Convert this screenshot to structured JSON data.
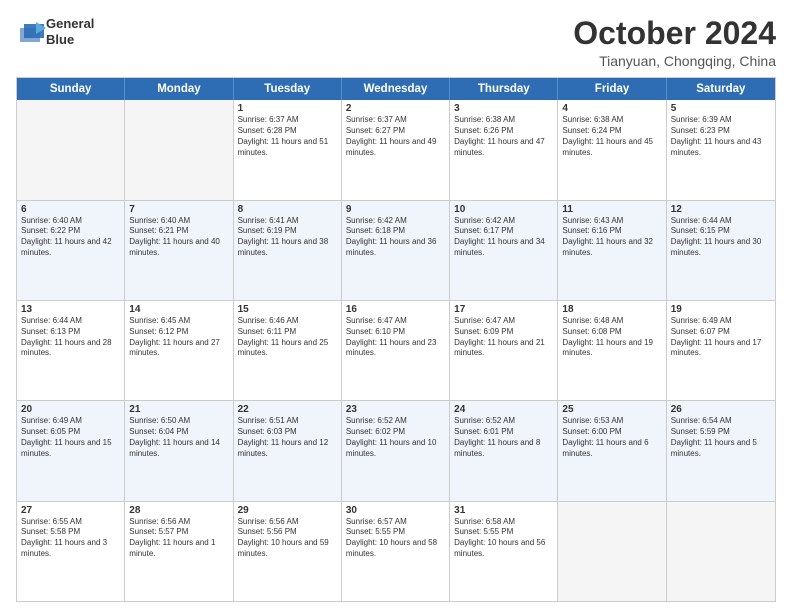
{
  "header": {
    "logo_line1": "General",
    "logo_line2": "Blue",
    "month": "October 2024",
    "location": "Tianyuan, Chongqing, China"
  },
  "days_of_week": [
    "Sunday",
    "Monday",
    "Tuesday",
    "Wednesday",
    "Thursday",
    "Friday",
    "Saturday"
  ],
  "weeks": [
    [
      {
        "day": "",
        "sunrise": "",
        "sunset": "",
        "daylight": "",
        "empty": true
      },
      {
        "day": "",
        "sunrise": "",
        "sunset": "",
        "daylight": "",
        "empty": true
      },
      {
        "day": "1",
        "sunrise": "Sunrise: 6:37 AM",
        "sunset": "Sunset: 6:28 PM",
        "daylight": "Daylight: 11 hours and 51 minutes."
      },
      {
        "day": "2",
        "sunrise": "Sunrise: 6:37 AM",
        "sunset": "Sunset: 6:27 PM",
        "daylight": "Daylight: 11 hours and 49 minutes."
      },
      {
        "day": "3",
        "sunrise": "Sunrise: 6:38 AM",
        "sunset": "Sunset: 6:26 PM",
        "daylight": "Daylight: 11 hours and 47 minutes."
      },
      {
        "day": "4",
        "sunrise": "Sunrise: 6:38 AM",
        "sunset": "Sunset: 6:24 PM",
        "daylight": "Daylight: 11 hours and 45 minutes."
      },
      {
        "day": "5",
        "sunrise": "Sunrise: 6:39 AM",
        "sunset": "Sunset: 6:23 PM",
        "daylight": "Daylight: 11 hours and 43 minutes."
      }
    ],
    [
      {
        "day": "6",
        "sunrise": "Sunrise: 6:40 AM",
        "sunset": "Sunset: 6:22 PM",
        "daylight": "Daylight: 11 hours and 42 minutes."
      },
      {
        "day": "7",
        "sunrise": "Sunrise: 6:40 AM",
        "sunset": "Sunset: 6:21 PM",
        "daylight": "Daylight: 11 hours and 40 minutes."
      },
      {
        "day": "8",
        "sunrise": "Sunrise: 6:41 AM",
        "sunset": "Sunset: 6:19 PM",
        "daylight": "Daylight: 11 hours and 38 minutes."
      },
      {
        "day": "9",
        "sunrise": "Sunrise: 6:42 AM",
        "sunset": "Sunset: 6:18 PM",
        "daylight": "Daylight: 11 hours and 36 minutes."
      },
      {
        "day": "10",
        "sunrise": "Sunrise: 6:42 AM",
        "sunset": "Sunset: 6:17 PM",
        "daylight": "Daylight: 11 hours and 34 minutes."
      },
      {
        "day": "11",
        "sunrise": "Sunrise: 6:43 AM",
        "sunset": "Sunset: 6:16 PM",
        "daylight": "Daylight: 11 hours and 32 minutes."
      },
      {
        "day": "12",
        "sunrise": "Sunrise: 6:44 AM",
        "sunset": "Sunset: 6:15 PM",
        "daylight": "Daylight: 11 hours and 30 minutes."
      }
    ],
    [
      {
        "day": "13",
        "sunrise": "Sunrise: 6:44 AM",
        "sunset": "Sunset: 6:13 PM",
        "daylight": "Daylight: 11 hours and 28 minutes."
      },
      {
        "day": "14",
        "sunrise": "Sunrise: 6:45 AM",
        "sunset": "Sunset: 6:12 PM",
        "daylight": "Daylight: 11 hours and 27 minutes."
      },
      {
        "day": "15",
        "sunrise": "Sunrise: 6:46 AM",
        "sunset": "Sunset: 6:11 PM",
        "daylight": "Daylight: 11 hours and 25 minutes."
      },
      {
        "day": "16",
        "sunrise": "Sunrise: 6:47 AM",
        "sunset": "Sunset: 6:10 PM",
        "daylight": "Daylight: 11 hours and 23 minutes."
      },
      {
        "day": "17",
        "sunrise": "Sunrise: 6:47 AM",
        "sunset": "Sunset: 6:09 PM",
        "daylight": "Daylight: 11 hours and 21 minutes."
      },
      {
        "day": "18",
        "sunrise": "Sunrise: 6:48 AM",
        "sunset": "Sunset: 6:08 PM",
        "daylight": "Daylight: 11 hours and 19 minutes."
      },
      {
        "day": "19",
        "sunrise": "Sunrise: 6:49 AM",
        "sunset": "Sunset: 6:07 PM",
        "daylight": "Daylight: 11 hours and 17 minutes."
      }
    ],
    [
      {
        "day": "20",
        "sunrise": "Sunrise: 6:49 AM",
        "sunset": "Sunset: 6:05 PM",
        "daylight": "Daylight: 11 hours and 15 minutes."
      },
      {
        "day": "21",
        "sunrise": "Sunrise: 6:50 AM",
        "sunset": "Sunset: 6:04 PM",
        "daylight": "Daylight: 11 hours and 14 minutes."
      },
      {
        "day": "22",
        "sunrise": "Sunrise: 6:51 AM",
        "sunset": "Sunset: 6:03 PM",
        "daylight": "Daylight: 11 hours and 12 minutes."
      },
      {
        "day": "23",
        "sunrise": "Sunrise: 6:52 AM",
        "sunset": "Sunset: 6:02 PM",
        "daylight": "Daylight: 11 hours and 10 minutes."
      },
      {
        "day": "24",
        "sunrise": "Sunrise: 6:52 AM",
        "sunset": "Sunset: 6:01 PM",
        "daylight": "Daylight: 11 hours and 8 minutes."
      },
      {
        "day": "25",
        "sunrise": "Sunrise: 6:53 AM",
        "sunset": "Sunset: 6:00 PM",
        "daylight": "Daylight: 11 hours and 6 minutes."
      },
      {
        "day": "26",
        "sunrise": "Sunrise: 6:54 AM",
        "sunset": "Sunset: 5:59 PM",
        "daylight": "Daylight: 11 hours and 5 minutes."
      }
    ],
    [
      {
        "day": "27",
        "sunrise": "Sunrise: 6:55 AM",
        "sunset": "Sunset: 5:58 PM",
        "daylight": "Daylight: 11 hours and 3 minutes."
      },
      {
        "day": "28",
        "sunrise": "Sunrise: 6:56 AM",
        "sunset": "Sunset: 5:57 PM",
        "daylight": "Daylight: 11 hours and 1 minute."
      },
      {
        "day": "29",
        "sunrise": "Sunrise: 6:56 AM",
        "sunset": "Sunset: 5:56 PM",
        "daylight": "Daylight: 10 hours and 59 minutes."
      },
      {
        "day": "30",
        "sunrise": "Sunrise: 6:57 AM",
        "sunset": "Sunset: 5:55 PM",
        "daylight": "Daylight: 10 hours and 58 minutes."
      },
      {
        "day": "31",
        "sunrise": "Sunrise: 6:58 AM",
        "sunset": "Sunset: 5:55 PM",
        "daylight": "Daylight: 10 hours and 56 minutes."
      },
      {
        "day": "",
        "sunrise": "",
        "sunset": "",
        "daylight": "",
        "empty": true
      },
      {
        "day": "",
        "sunrise": "",
        "sunset": "",
        "daylight": "",
        "empty": true
      }
    ]
  ]
}
